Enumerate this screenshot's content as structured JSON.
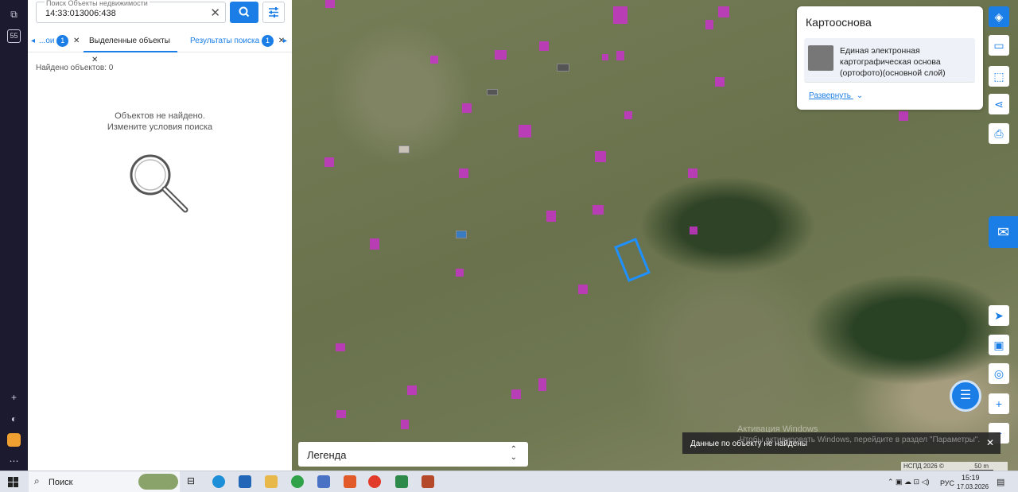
{
  "browser_rail": {
    "badge": "55"
  },
  "search": {
    "label": "Поиск Объекты недвижимости",
    "value": "14:33:013006:438"
  },
  "tabs": [
    {
      "label": "...ои",
      "count": "1"
    },
    {
      "label": "Выделенные объекты"
    },
    {
      "label": "Результаты поиска",
      "count": "1"
    }
  ],
  "results": {
    "found_text": "Найдено объектов: 0",
    "empty_line1": "Объектов не найдено.",
    "empty_line2": "Измените условия поиска"
  },
  "layer_card": {
    "title": "Картооснова",
    "layer_name": "Единая электронная картографическая основа (ортофото)(основной слой)",
    "expand_label": "Развернуть"
  },
  "legend": {
    "label": "Легенда"
  },
  "toast": {
    "message": "Данные по объекту не найдены"
  },
  "os_watermark": {
    "line1": "Активация Windows",
    "line2": "Чтобы активировать Windows, перейдите в раздел \"Параметры\"."
  },
  "scale": {
    "copyright": "НСПД 2026 ©",
    "distance": "50 m"
  },
  "taskbar": {
    "search_label": "Поиск",
    "language": "РУС",
    "time": "15:19",
    "date": "17.03.2026"
  },
  "colors": {
    "accent": "#1a7ee6",
    "plot": "#c534c8",
    "selection": "#1e90ff"
  },
  "icons": {
    "toolbar": [
      "layers-icon",
      "ruler-icon",
      "select-area-icon",
      "share-icon",
      "print-icon",
      "locate-icon",
      "minimap-icon",
      "geo-search-icon",
      "zoom-in-icon",
      "zoom-out-icon"
    ]
  }
}
